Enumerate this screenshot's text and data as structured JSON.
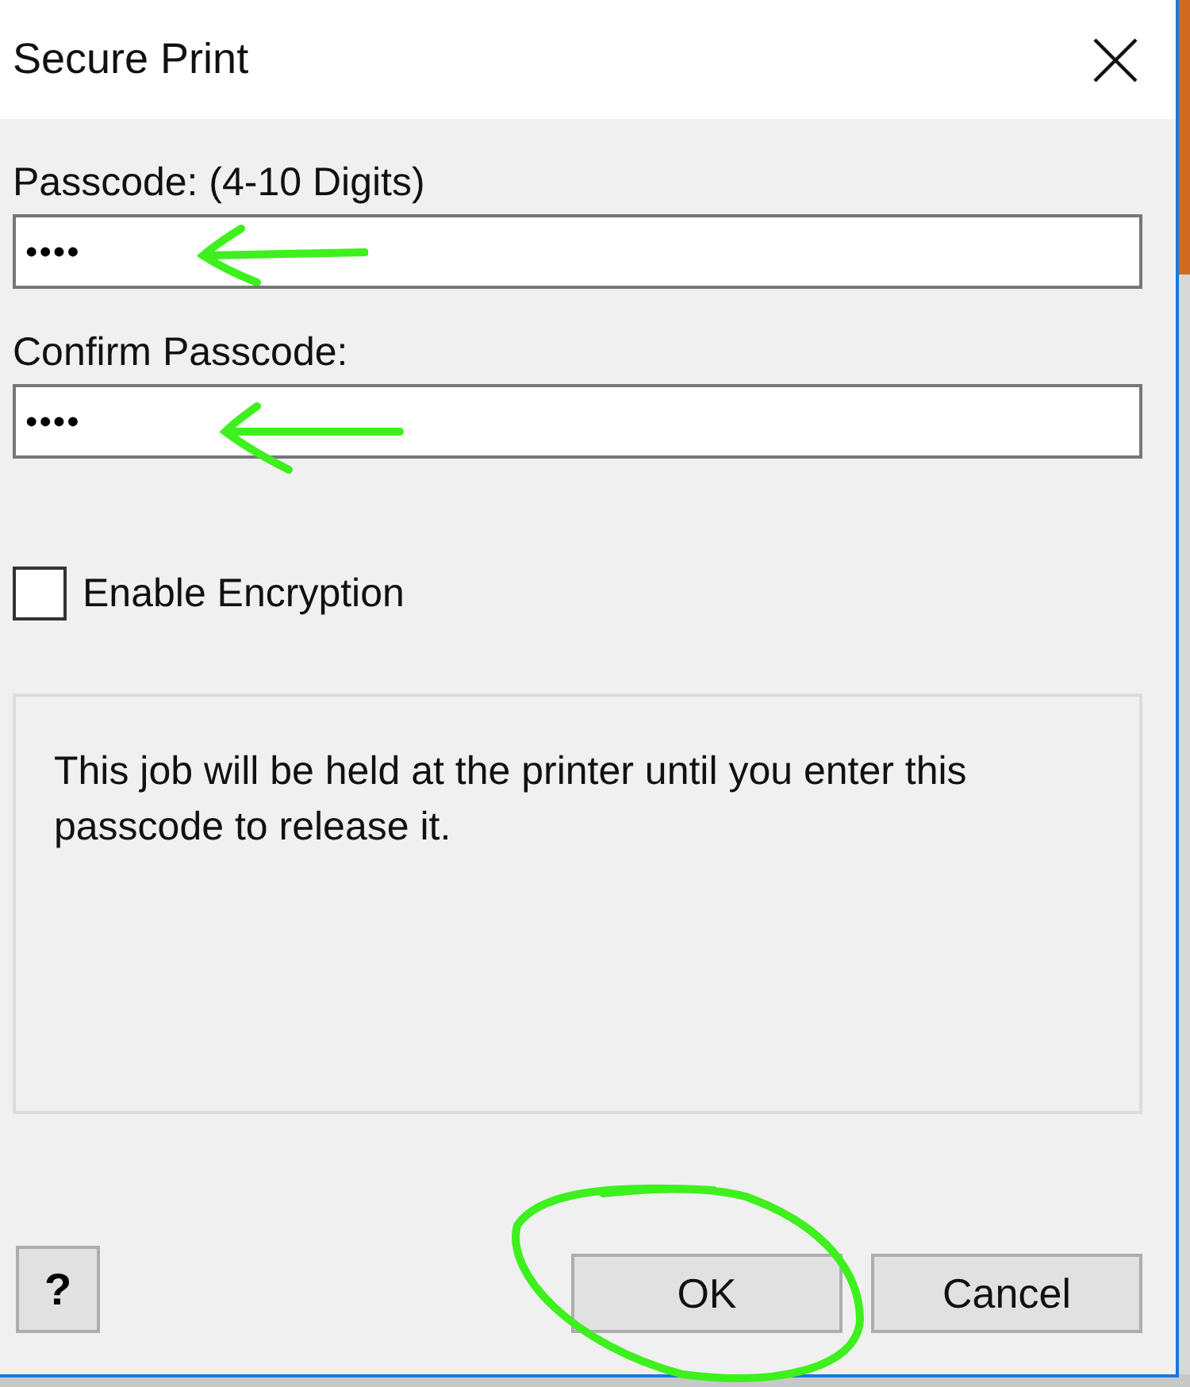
{
  "window": {
    "title": "Secure Print"
  },
  "fields": [
    {
      "label": "Passcode: (4-10 Digits)",
      "value": "••••"
    },
    {
      "label": "Confirm Passcode:",
      "value": "••••"
    }
  ],
  "encryption": {
    "label": "Enable Encryption",
    "checked": false
  },
  "info": "This job will be held at the printer until you enter this passcode to release it.",
  "buttons": {
    "help": "?",
    "ok": "OK",
    "cancel": "Cancel"
  }
}
